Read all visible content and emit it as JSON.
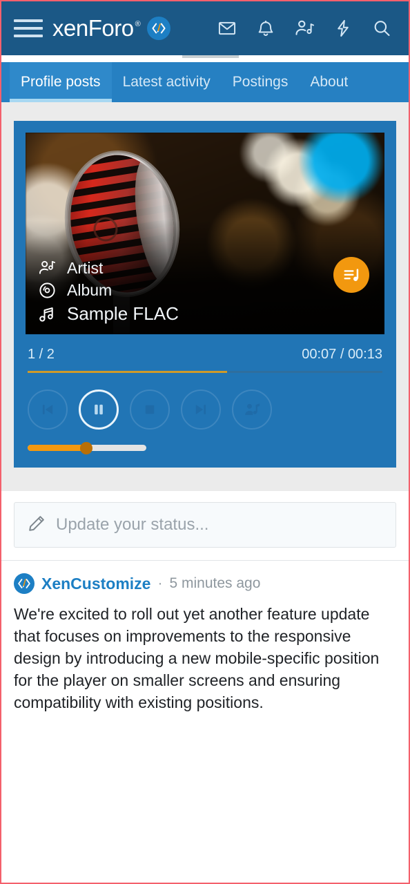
{
  "header": {
    "menu_icon": "hamburger-icon",
    "brand": "xenForo",
    "brand_tm": "®",
    "logo_icon": "xencustomize-logo-icon",
    "icons": [
      {
        "name": "inbox-icon",
        "label": "Inbox"
      },
      {
        "name": "alerts-icon",
        "label": "Alerts"
      },
      {
        "name": "members-icon",
        "label": "Members"
      },
      {
        "name": "whats-new-icon",
        "label": "What's new"
      },
      {
        "name": "search-icon",
        "label": "Search"
      }
    ],
    "bg_color": "#1b5886"
  },
  "tabs": {
    "items": [
      {
        "label": "Profile posts",
        "active": true
      },
      {
        "label": "Latest activity",
        "active": false
      },
      {
        "label": "Postings",
        "active": false
      },
      {
        "label": "About",
        "active": false
      }
    ],
    "bg_color": "#2680c2",
    "active_underline_color": "#a8d8f2"
  },
  "player": {
    "bg_color": "#2175b5",
    "artwork_alt": "Vintage red chrome microphone with warm bokeh lights",
    "metadata": [
      {
        "icon": "artist-icon",
        "label": "Artist"
      },
      {
        "icon": "album-icon",
        "label": "Album"
      },
      {
        "icon": "track-icon",
        "label": "Sample FLAC"
      }
    ],
    "playlist_button": {
      "icon": "playlist-icon",
      "color": "#f2980f"
    },
    "track_position": "1 / 2",
    "time": "00:07 / 00:13",
    "progress_percent": 56,
    "progress_fill_color": "#cf9a28",
    "controls": [
      {
        "name": "previous-button",
        "icon": "skip-previous-icon",
        "active": false
      },
      {
        "name": "pause-button",
        "icon": "pause-icon",
        "active": true
      },
      {
        "name": "stop-button",
        "icon": "stop-icon",
        "active": false
      },
      {
        "name": "next-button",
        "icon": "skip-next-icon",
        "active": false
      },
      {
        "name": "artist-info-button",
        "icon": "person-music-icon",
        "active": false
      }
    ],
    "volume_percent": 50,
    "volume_fill_color": "#f2980f",
    "volume_knob_color": "#b96f06"
  },
  "status": {
    "icon": "pencil-icon",
    "placeholder": "Update your status..."
  },
  "post": {
    "avatar_icon": "xencustomize-logo-icon",
    "author": "XenCustomize",
    "separator": "·",
    "time": "5 minutes ago",
    "body": "We're excited to roll out yet another feature update that focuses on improvements to the responsive design by introducing a new mobile-specific position for the player on smaller screens and ensuring compatibility with existing positions."
  }
}
